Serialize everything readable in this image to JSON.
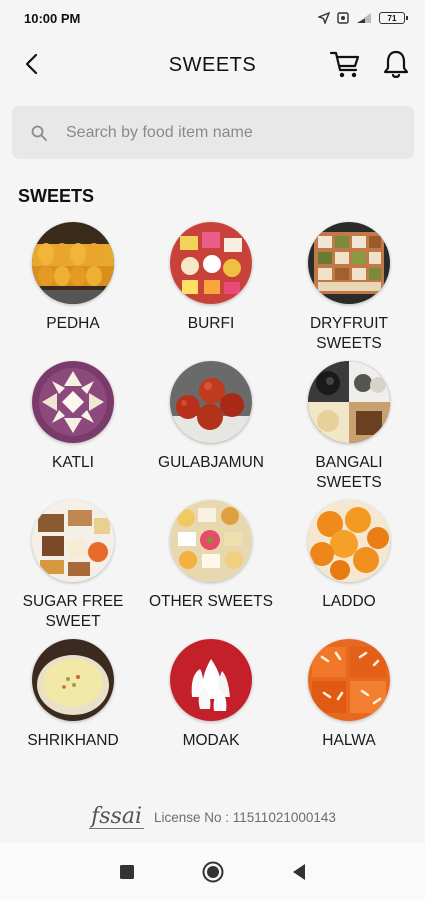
{
  "status_bar": {
    "time": "10:00 PM",
    "battery": "71"
  },
  "header": {
    "title": "SWEETS",
    "back_icon": "back-arrow-icon",
    "cart_icon": "cart-icon",
    "bell_icon": "bell-icon"
  },
  "search": {
    "placeholder": "Search by food item name",
    "value": ""
  },
  "section": {
    "title": "SWEETS"
  },
  "categories": [
    {
      "label": "PEDHA"
    },
    {
      "label": "BURFI"
    },
    {
      "label": "DRYFRUIT SWEETS"
    },
    {
      "label": "KATLI"
    },
    {
      "label": "GULABJAMUN"
    },
    {
      "label": "BANGALI SWEETS"
    },
    {
      "label": "SUGAR FREE SWEET"
    },
    {
      "label": "OTHER SWEETS"
    },
    {
      "label": "LADDO"
    },
    {
      "label": "SHRIKHAND"
    },
    {
      "label": "MODAK"
    },
    {
      "label": "HALWA"
    }
  ],
  "footer": {
    "logo_text": "fssai",
    "license": "License No : 11511021000143"
  },
  "navbar": {
    "recents_icon": "square-icon",
    "home_icon": "circle-icon",
    "back_icon": "triangle-back-icon"
  },
  "colors": {
    "background": "#f5f5f5",
    "search_bg": "#e8e8e8",
    "text": "#1a1a1a"
  }
}
